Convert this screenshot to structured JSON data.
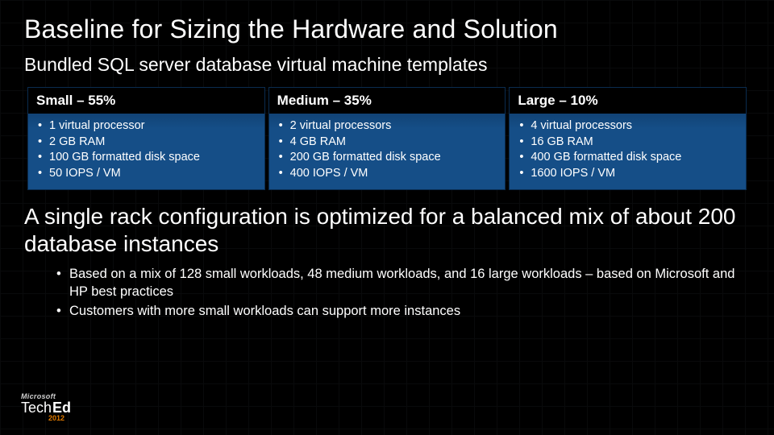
{
  "title": "Baseline for Sizing the Hardware and Solution",
  "subtitle": "Bundled SQL server database virtual machine templates",
  "cards": [
    {
      "header": "Small – 55%",
      "items": [
        "1 virtual processor",
        "2 GB RAM",
        "100 GB formatted disk space",
        "50 IOPS / VM"
      ]
    },
    {
      "header": "Medium – 35%",
      "items": [
        "2 virtual processors",
        "4 GB RAM",
        "200 GB formatted disk space",
        "400 IOPS / VM"
      ]
    },
    {
      "header": "Large – 10%",
      "items": [
        "4 virtual processors",
        "16 GB RAM",
        "400 GB formatted disk space",
        "1600 IOPS / VM"
      ]
    }
  ],
  "summary": "A single rack configuration is optimized for a balanced mix of about 200 database instances",
  "summary_bullets": [
    "Based on a mix of 128 small workloads, 48 medium workloads, and 16 large workloads – based on Microsoft and HP best practices",
    "Customers with more small workloads can support more instances"
  ],
  "logo": {
    "brand": "Microsoft",
    "product_a": "Tech",
    "product_b": "Ed",
    "year": "2012"
  }
}
